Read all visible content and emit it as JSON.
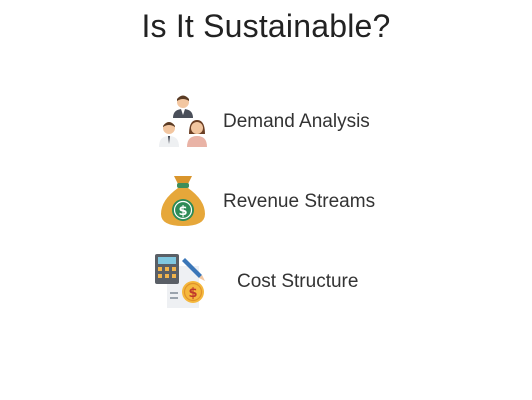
{
  "slide": {
    "title": "Is It Sustainable?",
    "items": [
      {
        "label": "Demand Analysis",
        "icon": "people-group-icon"
      },
      {
        "label": "Revenue Streams",
        "icon": "money-bag-icon"
      },
      {
        "label": "Cost Structure",
        "icon": "calculator-invoice-icon"
      }
    ]
  },
  "colors": {
    "title_text": "#222222",
    "label_text": "#333333",
    "bag_gold": "#e6a73a",
    "bag_coin_green": "#2e8b57"
  }
}
